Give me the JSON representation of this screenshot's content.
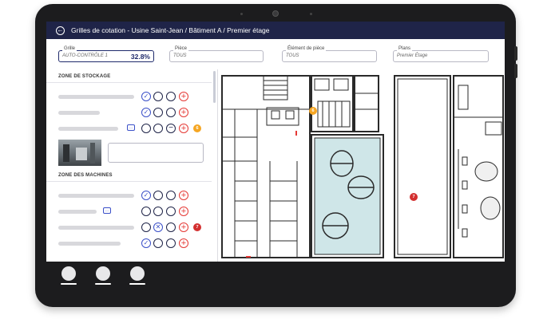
{
  "header": {
    "title": "Grilles de cotation - Usine Saint-Jean / Bâtiment A / Premier étage"
  },
  "filters": {
    "grille": {
      "label": "Grille",
      "value": "AUTO-CONTRÔLE 1",
      "score": "32.8%"
    },
    "piece": {
      "label": "Pièce",
      "value": "TOUS"
    },
    "element": {
      "label": "Élément de pièce",
      "value": "TOUS"
    },
    "plans": {
      "label": "Plans",
      "value": "Premier Étage"
    }
  },
  "sections": {
    "stockage": "ZONE DE STOCKAGE",
    "machines": "ZONE DES MACHINES"
  },
  "badges": {
    "row3_orange": "6",
    "row7_red": "7",
    "plan_orange": "6",
    "plan_red": "7"
  },
  "icons": {
    "check": "✓",
    "cross": "✕",
    "minus": "−",
    "plus": "+",
    "back": "←",
    "comment": "…"
  },
  "colors": {
    "header_bg": "#1f2448",
    "accent_blue": "#3a4fc8",
    "plus_red": "#e53935",
    "badge_orange": "#f5a623",
    "badge_red": "#d32f2f"
  }
}
